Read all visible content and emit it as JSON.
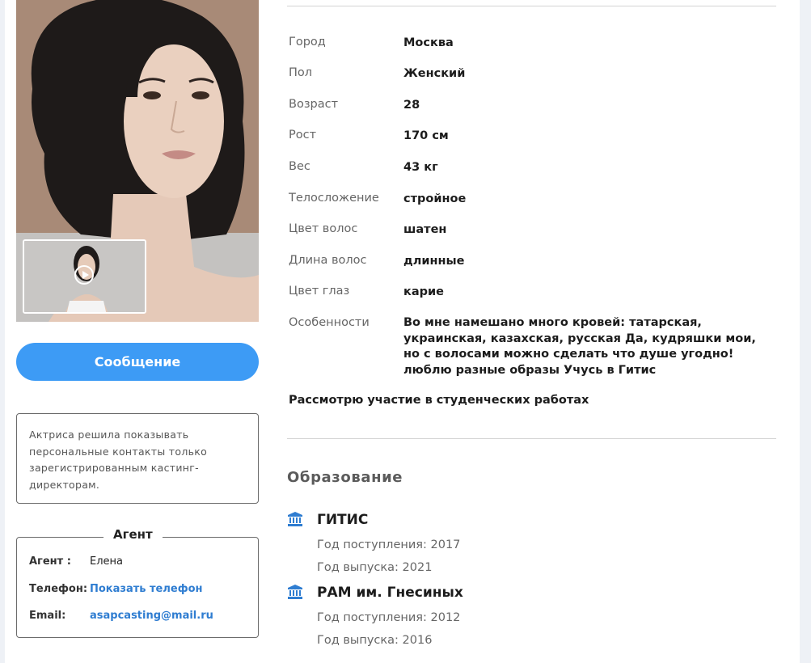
{
  "profile": {
    "message_button": "Сообщение",
    "notice": "Актриса решила показывать персональные контакты только зарегистрированным кастинг-директорам."
  },
  "agent": {
    "title": "Агент",
    "agent_label": "Агент :",
    "agent_value": "Елена",
    "phone_label": "Телефон:",
    "phone_value": "Показать телефон",
    "email_label": "Email:",
    "email_value": "asapcasting@mail.ru"
  },
  "attributes": [
    {
      "label": "Город",
      "value": "Москва"
    },
    {
      "label": "Пол",
      "value": "Женский"
    },
    {
      "label": "Возраст",
      "value": "28"
    },
    {
      "label": "Рост",
      "value": "170 см"
    },
    {
      "label": "Вес",
      "value": "43 кг"
    },
    {
      "label": "Телосложение",
      "value": "стройное"
    },
    {
      "label": "Цвет волос",
      "value": "шатен"
    },
    {
      "label": "Длина волос",
      "value": "длинные"
    },
    {
      "label": "Цвет глаз",
      "value": "карие"
    },
    {
      "label": "Особенности",
      "value": "Во мне намешано много кровей: татарская, украинская, казахская, русская Да, кудряшки мои, но с волосами можно сделать что душе угодно! люблю разные образы Учусь в Гитис"
    }
  ],
  "note": "Рассмотрю участие в студенческих работах",
  "education": {
    "title": "Образование",
    "items": [
      {
        "name": "ГИТИС",
        "start": "Год поступления: 2017",
        "end": "Год выпуска: 2021"
      },
      {
        "name": "РАМ им. Гнесиных",
        "start": "Год поступления: 2012",
        "end": "Год выпуска: 2016"
      }
    ]
  },
  "colors": {
    "accent": "#3d9bf5",
    "link": "#2f7dd1",
    "icon": "#2f7dd1"
  }
}
